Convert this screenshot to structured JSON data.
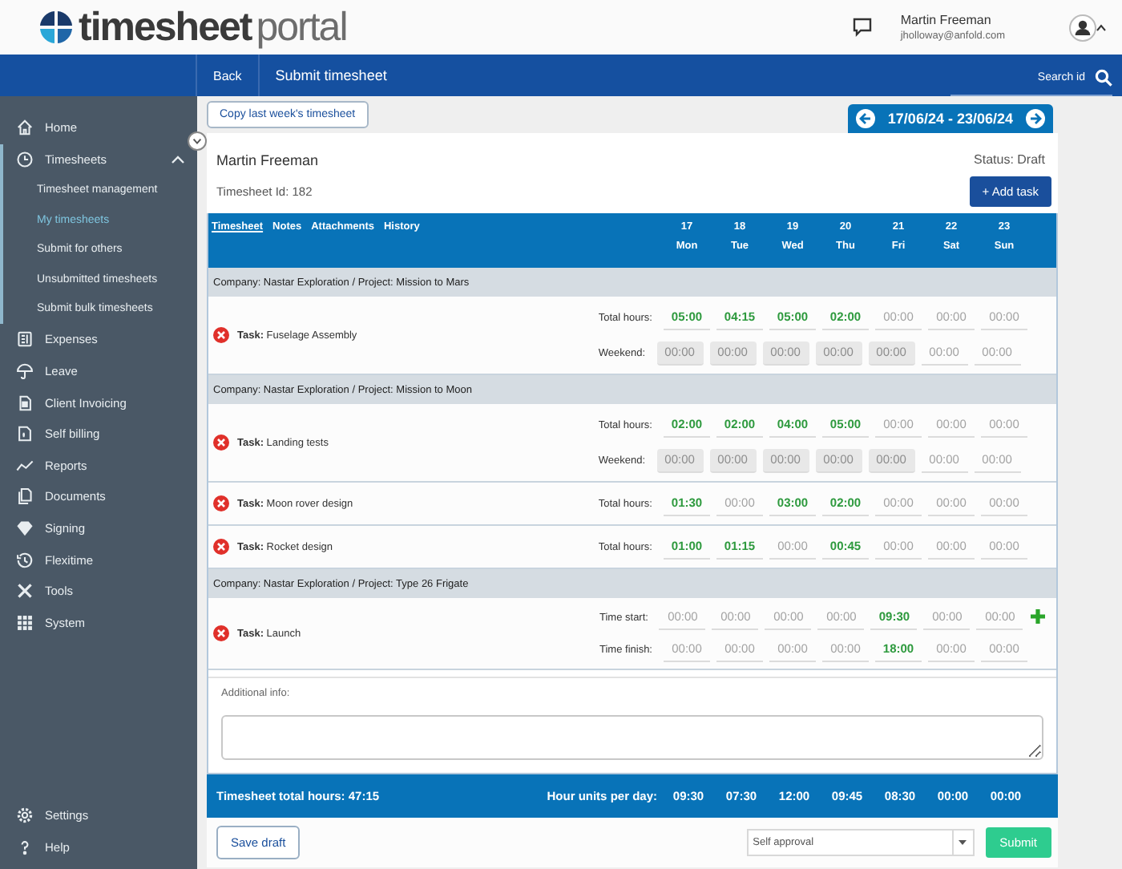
{
  "header": {
    "logo_main": "timesheet",
    "logo_rest": "portal",
    "user_name": "Martin Freeman",
    "user_email": "jholloway@anfold.com"
  },
  "navbar": {
    "back": "Back",
    "title": "Submit timesheet",
    "search": {
      "placeholder": "Search id"
    }
  },
  "sidebar": {
    "items": [
      {
        "label": "Home",
        "selected": false
      },
      {
        "label": "Timesheets",
        "selected": true,
        "expanded": true,
        "children": [
          {
            "label": "Timesheet management",
            "selected": false
          },
          {
            "label": "My timesheets",
            "selected": true
          },
          {
            "label": "Submit for others",
            "selected": false
          },
          {
            "label": "Unsubmitted timesheets",
            "selected": false
          },
          {
            "label": "Submit bulk timesheets",
            "selected": false
          }
        ]
      },
      {
        "label": "Expenses",
        "selected": false
      },
      {
        "label": "Leave",
        "selected": false
      },
      {
        "label": "Client Invoicing",
        "selected": false
      },
      {
        "label": "Self billing",
        "selected": false
      },
      {
        "label": "Reports",
        "selected": false
      },
      {
        "label": "Documents",
        "selected": false
      },
      {
        "label": "Signing",
        "selected": false
      },
      {
        "label": "Flexitime",
        "selected": false
      },
      {
        "label": "Tools",
        "selected": false
      },
      {
        "label": "System",
        "selected": false
      }
    ],
    "footer_items": [
      {
        "label": "Settings"
      },
      {
        "label": "Help"
      }
    ]
  },
  "copy_button": "Copy last week's timesheet",
  "week": "17/06/24 - 23/06/24",
  "employee": "Martin Freeman",
  "status": "Status: Draft",
  "timesheet_id": "Timesheet Id: 182",
  "add_task": "+ Add task",
  "tabs": [
    {
      "label": "Timesheet",
      "selected": true
    },
    {
      "label": "Notes",
      "selected": false
    },
    {
      "label": "Attachments",
      "selected": false
    },
    {
      "label": "History",
      "selected": false
    }
  ],
  "days": [
    {
      "num": "17",
      "name": "Mon"
    },
    {
      "num": "18",
      "name": "Tue"
    },
    {
      "num": "19",
      "name": "Wed"
    },
    {
      "num": "20",
      "name": "Thu"
    },
    {
      "num": "21",
      "name": "Fri"
    },
    {
      "num": "22",
      "name": "Sat"
    },
    {
      "num": "23",
      "name": "Sun"
    }
  ],
  "groups": [
    {
      "header": "Company: Nastar Exploration / Project: Mission to Mars",
      "tasks": [
        {
          "name": "**Task:** Fuselage Assembly",
          "addable": false,
          "lines": [
            {
              "label": "Total hours:",
              "cells": [
                {
                  "value": "05:00",
                  "disabled": false
                },
                {
                  "value": "04:15",
                  "disabled": false
                },
                {
                  "value": "05:00",
                  "disabled": false
                },
                {
                  "value": "02:00",
                  "disabled": false
                },
                {
                  "placeholder": "00:00",
                  "disabled": false
                },
                {
                  "placeholder": "00:00",
                  "disabled": false
                },
                {
                  "placeholder": "00:00",
                  "disabled": false
                }
              ]
            },
            {
              "label": "Weekend:",
              "cells": [
                {
                  "placeholder": "00:00",
                  "disabled": true
                },
                {
                  "placeholder": "00:00",
                  "disabled": true
                },
                {
                  "placeholder": "00:00",
                  "disabled": true
                },
                {
                  "placeholder": "00:00",
                  "disabled": true
                },
                {
                  "placeholder": "00:00",
                  "disabled": true
                },
                {
                  "placeholder": "00:00",
                  "disabled": false
                },
                {
                  "placeholder": "00:00",
                  "disabled": false
                }
              ]
            }
          ]
        }
      ]
    },
    {
      "header": "Company: Nastar Exploration / Project: Mission to Moon",
      "tasks": [
        {
          "name": "**Task:** Landing tests",
          "addable": false,
          "lines": [
            {
              "label": "Total hours:",
              "cells": [
                {
                  "value": "02:00",
                  "disabled": false
                },
                {
                  "value": "02:00",
                  "disabled": false
                },
                {
                  "value": "04:00",
                  "disabled": false
                },
                {
                  "value": "05:00",
                  "disabled": false
                },
                {
                  "placeholder": "00:00",
                  "disabled": false
                },
                {
                  "placeholder": "00:00",
                  "disabled": false
                },
                {
                  "placeholder": "00:00",
                  "disabled": false
                }
              ]
            },
            {
              "label": "Weekend:",
              "cells": [
                {
                  "placeholder": "00:00",
                  "disabled": true
                },
                {
                  "placeholder": "00:00",
                  "disabled": true
                },
                {
                  "placeholder": "00:00",
                  "disabled": true
                },
                {
                  "placeholder": "00:00",
                  "disabled": true
                },
                {
                  "placeholder": "00:00",
                  "disabled": true
                },
                {
                  "placeholder": "00:00",
                  "disabled": false
                },
                {
                  "placeholder": "00:00",
                  "disabled": false
                }
              ]
            }
          ]
        },
        {
          "name": "**Task:** Moon rover design",
          "addable": false,
          "lines": [
            {
              "label": "Total hours:",
              "cells": [
                {
                  "value": "01:30",
                  "disabled": false
                },
                {
                  "placeholder": "00:00",
                  "disabled": false
                },
                {
                  "value": "03:00",
                  "disabled": false
                },
                {
                  "value": "02:00",
                  "disabled": false
                },
                {
                  "placeholder": "00:00",
                  "disabled": false
                },
                {
                  "placeholder": "00:00",
                  "disabled": false
                },
                {
                  "placeholder": "00:00",
                  "disabled": false
                }
              ]
            }
          ]
        },
        {
          "name": "**Task:** Rocket design",
          "addable": false,
          "lines": [
            {
              "label": "Total hours:",
              "cells": [
                {
                  "value": "01:00",
                  "disabled": false
                },
                {
                  "value": "01:15",
                  "disabled": false
                },
                {
                  "placeholder": "00:00",
                  "disabled": false
                },
                {
                  "value": "00:45",
                  "disabled": false
                },
                {
                  "placeholder": "00:00",
                  "disabled": false
                },
                {
                  "placeholder": "00:00",
                  "disabled": false
                },
                {
                  "placeholder": "00:00",
                  "disabled": false
                }
              ]
            }
          ]
        }
      ]
    },
    {
      "header": "Company: Nastar Exploration / Project: Type 26 Frigate",
      "tasks": [
        {
          "name": "**Task:** Launch",
          "addable": true,
          "lines": [
            {
              "label": "Time start:",
              "cells": [
                {
                  "placeholder": "00:00",
                  "disabled": false
                },
                {
                  "placeholder": "00:00",
                  "disabled": false
                },
                {
                  "placeholder": "00:00",
                  "disabled": false
                },
                {
                  "placeholder": "00:00",
                  "disabled": false
                },
                {
                  "value": "09:30",
                  "disabled": false
                },
                {
                  "placeholder": "00:00",
                  "disabled": false
                },
                {
                  "placeholder": "00:00",
                  "disabled": false
                }
              ]
            },
            {
              "label": "Time finish:",
              "cells": [
                {
                  "placeholder": "00:00",
                  "disabled": false
                },
                {
                  "placeholder": "00:00",
                  "disabled": false
                },
                {
                  "placeholder": "00:00",
                  "disabled": false
                },
                {
                  "placeholder": "00:00",
                  "disabled": false
                },
                {
                  "value": "18:00",
                  "disabled": false
                },
                {
                  "placeholder": "00:00",
                  "disabled": false
                },
                {
                  "placeholder": "00:00",
                  "disabled": false
                }
              ]
            }
          ]
        }
      ]
    }
  ],
  "additional_info": {
    "label": "Additional info:"
  },
  "totals": {
    "label": "Timesheet total hours: 47:15",
    "per_day_label": "Hour units per day:",
    "per_day": [
      "09:30",
      "07:30",
      "12:00",
      "09:45",
      "08:30",
      "00:00",
      "00:00"
    ]
  },
  "save_draft": "Save draft",
  "approval": {
    "value": "Self approval"
  },
  "submit": "Submit"
}
